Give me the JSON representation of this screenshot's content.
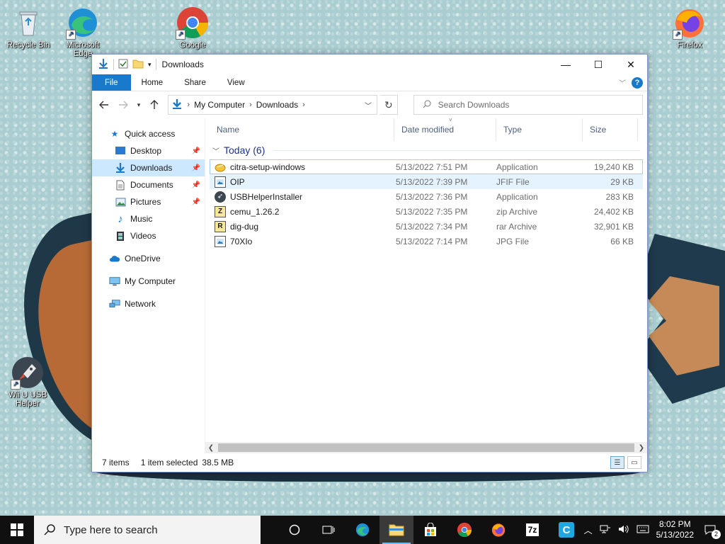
{
  "desktop": {
    "icons": [
      {
        "label": "Recycle Bin"
      },
      {
        "label": "Microsoft Edge"
      },
      {
        "label": "Google"
      },
      {
        "label": "Firefox"
      },
      {
        "label": "Wii U USB Helper"
      }
    ]
  },
  "window": {
    "title": "Downloads",
    "controls": {
      "minimize": "—",
      "maximize": "☐",
      "close": "✕"
    },
    "ribbon_tabs": [
      "File",
      "Home",
      "Share",
      "View"
    ],
    "help_label": "?",
    "address": {
      "crumbs": [
        "My Computer",
        "Downloads"
      ]
    },
    "search": {
      "placeholder": "Search Downloads"
    },
    "nav": [
      {
        "label": "Quick access"
      },
      {
        "label": "Desktop"
      },
      {
        "label": "Downloads"
      },
      {
        "label": "Documents"
      },
      {
        "label": "Pictures"
      },
      {
        "label": "Music"
      },
      {
        "label": "Videos"
      },
      {
        "label": "OneDrive"
      },
      {
        "label": "My Computer"
      },
      {
        "label": "Network"
      }
    ],
    "columns": {
      "name": "Name",
      "date": "Date modified",
      "type": "Type",
      "size": "Size"
    },
    "group_label": "Today (6)",
    "files": [
      {
        "name": "citra-setup-windows",
        "date": "5/13/2022 7:51 PM",
        "type": "Application",
        "size": "19,240 KB",
        "icon": "installer-icon"
      },
      {
        "name": "OIP",
        "date": "5/13/2022 7:39 PM",
        "type": "JFIF File",
        "size": "29 KB",
        "icon": "image-file-icon"
      },
      {
        "name": "USBHelperInstaller",
        "date": "5/13/2022 7:36 PM",
        "type": "Application",
        "size": "283 KB",
        "icon": "app-icon"
      },
      {
        "name": "cemu_1.26.2",
        "date": "5/13/2022 7:35 PM",
        "type": "zip Archive",
        "size": "24,402 KB",
        "icon": "zip-icon"
      },
      {
        "name": "dig-dug",
        "date": "5/13/2022 7:34 PM",
        "type": "rar Archive",
        "size": "32,901 KB",
        "icon": "rar-icon"
      },
      {
        "name": "70XIo",
        "date": "5/13/2022 7:14 PM",
        "type": "JPG File",
        "size": "66 KB",
        "icon": "image-file-icon"
      }
    ],
    "status": {
      "count": "7 items",
      "selection": "1 item selected",
      "size": "38.5 MB"
    }
  },
  "taskbar": {
    "search_placeholder": "Type here to search",
    "time": "8:02 PM",
    "date": "5/13/2022",
    "notification_count": "2",
    "seven_zip_label": "7z"
  },
  "colors": {
    "accent": "#1979ca",
    "selection": "#cce8ff",
    "taskbar": "#101010"
  }
}
